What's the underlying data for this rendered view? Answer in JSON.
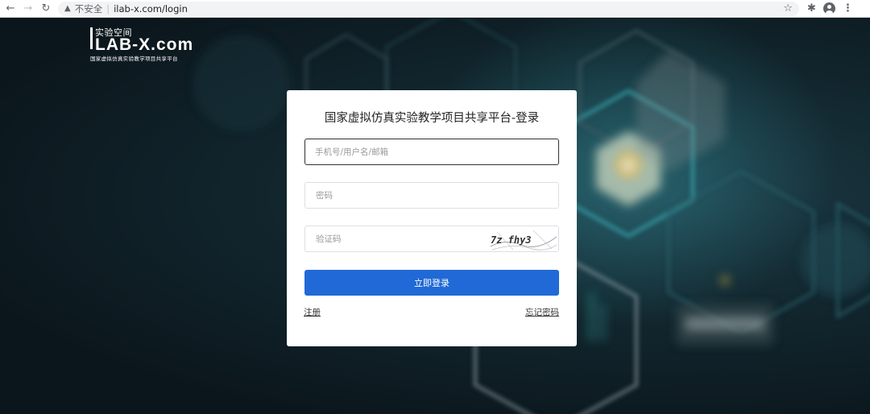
{
  "browser": {
    "back_icon": "arrow-left-icon",
    "forward_icon": "arrow-right-icon",
    "reload_icon": "reload-icon",
    "security_label": "不安全",
    "separator": "|",
    "url": "ilab-x.com/login",
    "bookmark_icon": "star-icon",
    "extensions_icon": "puzzle-icon",
    "profile_icon": "account-icon",
    "menu_icon": "kebab-menu-icon"
  },
  "logo": {
    "line1": "实验空间",
    "line2": "LAB-X.com",
    "line3": "国家虚拟仿真实验教学项目共享平台"
  },
  "login": {
    "title": "国家虚拟仿真实验教学项目共享平台-登录",
    "username_placeholder": "手机号/用户名/邮箱",
    "password_placeholder": "密码",
    "captcha_placeholder": "验证码",
    "captcha_text": "7z fhy3",
    "submit_label": "立即登录",
    "register_label": "注册",
    "forgot_label": "忘记密码"
  },
  "colors": {
    "primary": "#2069d6",
    "background": "#0d1b22",
    "card": "#ffffff"
  }
}
